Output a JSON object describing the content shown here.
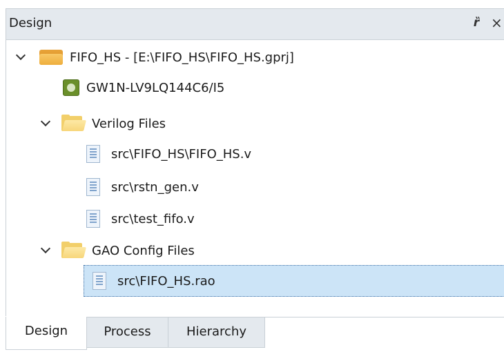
{
  "panel": {
    "title": "Design",
    "float_icon": "float-window-icon",
    "close_icon": "close-icon",
    "float_glyph": "ȑ",
    "close_glyph": "×"
  },
  "tree": {
    "project": {
      "label": "FIFO_HS - [E:\\FIFO_HS\\FIFO_HS.gprj]",
      "icon": "project-folder-icon",
      "expanded": true
    },
    "device": {
      "label": "GW1N-LV9LQ144C6/I5",
      "icon": "chip-icon"
    },
    "verilog_folder": {
      "label": "Verilog Files",
      "icon": "folder-icon",
      "expanded": true
    },
    "verilog_files": [
      {
        "label": "src\\FIFO_HS\\FIFO_HS.v",
        "icon": "file-icon"
      },
      {
        "label": "src\\rstn_gen.v",
        "icon": "file-icon"
      },
      {
        "label": "src\\test_fifo.v",
        "icon": "file-icon"
      }
    ],
    "gao_folder": {
      "label": "GAO Config Files",
      "icon": "folder-icon",
      "expanded": true
    },
    "gao_files": [
      {
        "label": "src\\FIFO_HS.rao",
        "icon": "file-icon",
        "selected": true
      }
    ]
  },
  "tabs": [
    {
      "label": "Design",
      "active": true
    },
    {
      "label": "Process",
      "active": false
    },
    {
      "label": "Hierarchy",
      "active": false
    }
  ],
  "colors": {
    "header_bg": "#e4e9ee",
    "selection_bg": "#cce4f7",
    "folder_yellow": "#f2cf6a",
    "project_orange": "#e8a43a"
  }
}
